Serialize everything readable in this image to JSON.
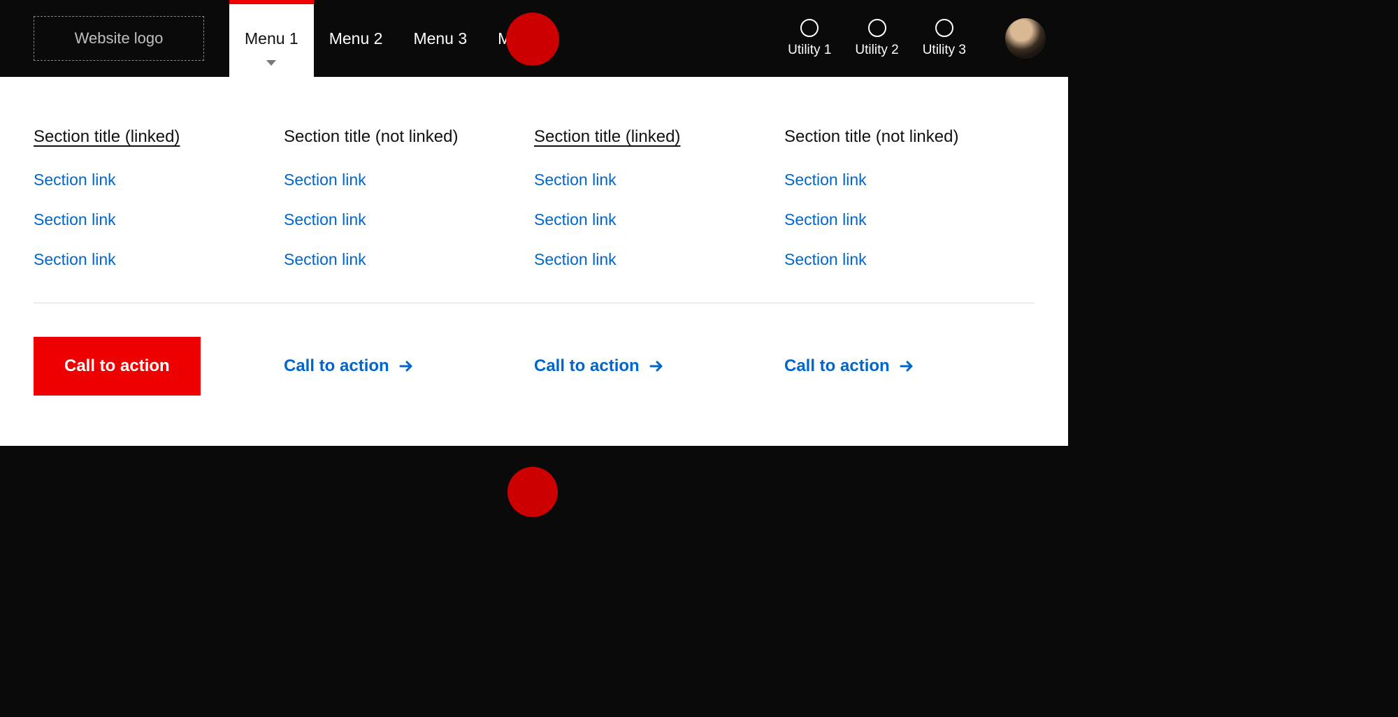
{
  "header": {
    "logo_placeholder": "Website logo",
    "menu_items": [
      "Menu 1",
      "Menu 2",
      "Menu 3",
      "Menu 4"
    ],
    "active_menu_index": 0,
    "utilities": [
      "Utility 1",
      "Utility 2",
      "Utility 3"
    ]
  },
  "megamenu": {
    "columns": [
      {
        "title": "Section title (linked)",
        "linked": true,
        "links": [
          "Section link",
          "Section link",
          "Section link"
        ],
        "cta": {
          "label": "Call to action",
          "style": "button"
        }
      },
      {
        "title": "Section title (not linked)",
        "linked": false,
        "links": [
          "Section link",
          "Section link",
          "Section link"
        ],
        "cta": {
          "label": "Call to action",
          "style": "link"
        }
      },
      {
        "title": "Section title (linked)",
        "linked": true,
        "links": [
          "Section link",
          "Section link",
          "Section link"
        ],
        "cta": {
          "label": "Call to action",
          "style": "link"
        }
      },
      {
        "title": "Section title (not linked)",
        "linked": false,
        "links": [
          "Section link",
          "Section link",
          "Section link"
        ],
        "cta": {
          "label": "Call to action",
          "style": "link"
        }
      }
    ]
  },
  "colors": {
    "accent": "#e00",
    "link": "#0066cc",
    "header_bg": "#0a0a0a"
  }
}
